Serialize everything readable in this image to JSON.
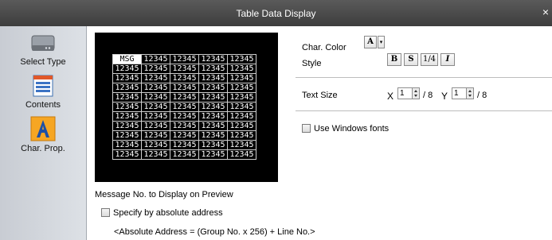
{
  "window": {
    "title": "Table Data Display",
    "close_glyph": "×"
  },
  "sidebar": {
    "items": [
      {
        "label": "Select Type",
        "icon": "device-icon"
      },
      {
        "label": "Contents",
        "icon": "table-icon"
      },
      {
        "label": "Char. Prop.",
        "icon": "letter-a-icon"
      }
    ]
  },
  "preview": {
    "header": [
      "MSG",
      "12345",
      "12345",
      "12345",
      "12345"
    ],
    "row_values": [
      "12345",
      "12345",
      "12345",
      "12345",
      "12345"
    ],
    "row_count": 10
  },
  "char_color": {
    "label": "Char. Color",
    "value": "A"
  },
  "style": {
    "label": "Style",
    "bold": "B",
    "shadow": "S",
    "quarter": "1/4",
    "italic": "I"
  },
  "text_size": {
    "label": "Text Size",
    "x_label": "X",
    "x_value": "1",
    "x_denominator": "/ 8",
    "y_label": "Y",
    "y_value": "1",
    "y_denominator": "/ 8"
  },
  "use_windows_fonts": {
    "label": "Use Windows fonts",
    "checked": false
  },
  "message_no": {
    "label": "Message No. to Display on Preview",
    "absolute_label": "Specify by absolute address",
    "absolute_checked": false,
    "formula": "<Absolute Address = (Group No. x 256) + Line No.>"
  },
  "colors": {
    "titlebar": "#4a4a4a",
    "sidebar": "#d3d7dd",
    "preview_bg": "#000000",
    "accent": "#1f6fd1"
  }
}
